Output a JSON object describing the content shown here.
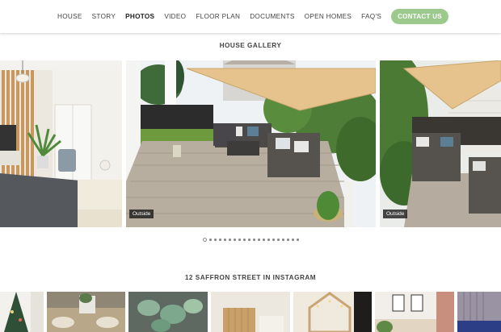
{
  "nav": {
    "items": [
      {
        "label": "HOUSE",
        "active": false
      },
      {
        "label": "STORY",
        "active": false
      },
      {
        "label": "PHOTOS",
        "active": true
      },
      {
        "label": "VIDEO",
        "active": false
      },
      {
        "label": "FLOOR PLAN",
        "active": false
      },
      {
        "label": "DOCUMENTS",
        "active": false
      },
      {
        "label": "OPEN HOMES",
        "active": false
      },
      {
        "label": "FAQ'S",
        "active": false
      }
    ],
    "contact_label": "CONTACT US",
    "accent_color": "#9cc98c"
  },
  "gallery": {
    "title": "HOUSE GALLERY",
    "slides": [
      {
        "caption": ""
      },
      {
        "caption": "Outside"
      },
      {
        "caption": "Outside"
      }
    ],
    "dot_count": 20,
    "active_dot": 0
  },
  "instagram": {
    "title": "12 SAFFRON STREET IN INSTAGRAM"
  }
}
